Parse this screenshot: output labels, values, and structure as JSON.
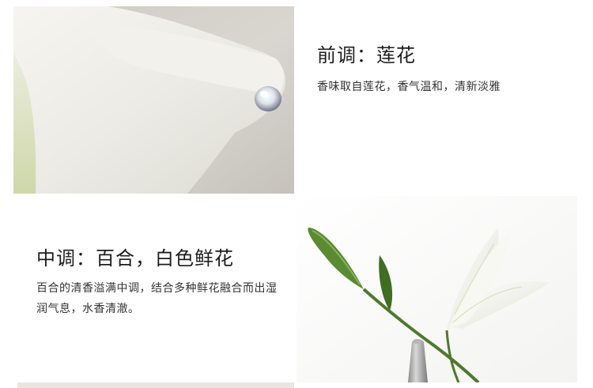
{
  "top_note": {
    "heading": "前调：莲花",
    "description": "香味取自莲花，香气温和，清新淡雅"
  },
  "middle_note": {
    "heading": "中调：百合，白色鲜花",
    "description": "百合的清香溢满中调，结合多种鲜花融合而出湿润气息，水香清澈。"
  },
  "images": {
    "top": "white-calla-petal-with-water-drop",
    "middle": "white-lily-with-bud-and-vase",
    "bottom": "cropped-next-image"
  },
  "colors": {
    "background": "#ffffff",
    "text": "#222222",
    "petal": "#f1efea",
    "stem": "#4c7a2c"
  }
}
